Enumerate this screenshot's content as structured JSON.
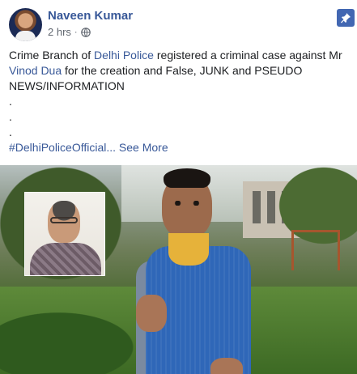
{
  "post": {
    "author": "Naveen Kumar",
    "time": "2 hrs",
    "separator": "·",
    "text_parts": {
      "p1": "Crime Branch of ",
      "link1": "Delhi Police",
      "p2": " registered a criminal case against Mr ",
      "link2": "Vinod Dua",
      "p3": " for the creation and False, JUNK and PSEUDO NEWS/INFORMATION"
    },
    "dots": [
      ".",
      ".",
      "."
    ],
    "hashtag": "#DelhiPoliceOfficial",
    "ellipsis": "...",
    "see_more": "See More"
  },
  "icons": {
    "privacy": "globe-icon",
    "pin": "pin-icon"
  },
  "colors": {
    "link": "#385898",
    "pin_bg": "#4267b2"
  }
}
